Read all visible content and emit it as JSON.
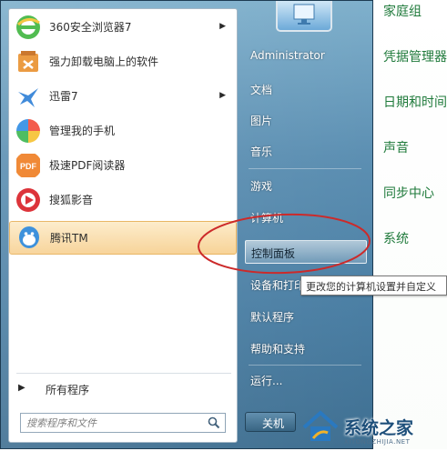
{
  "right_window": {
    "links": [
      "家庭组",
      "凭据管理器",
      "日期和时间",
      "声音",
      "同步中心",
      "系统"
    ]
  },
  "programs": [
    {
      "label": "360安全浏览器7",
      "icon": "360-browser-icon",
      "submenu": true
    },
    {
      "label": "强力卸载电脑上的软件",
      "icon": "uninstall-tool-icon",
      "submenu": false
    },
    {
      "label": "迅雷7",
      "icon": "thunder-bird-icon",
      "submenu": true
    },
    {
      "label": "管理我的手机",
      "icon": "phone-manager-icon",
      "submenu": false
    },
    {
      "label": "极速PDF阅读器",
      "icon": "pdf-reader-icon",
      "submenu": false
    },
    {
      "label": "搜狐影音",
      "icon": "sohu-player-icon",
      "submenu": false
    },
    {
      "label": "腾讯TM",
      "icon": "tencent-tm-icon",
      "submenu": false
    }
  ],
  "all_programs": "所有程序",
  "search": {
    "placeholder": "搜索程序和文件"
  },
  "right_menu": {
    "user": "Administrator",
    "documents": "文档",
    "pictures": "图片",
    "music": "音乐",
    "games": "游戏",
    "computer": "计算机",
    "control_panel": "控制面板",
    "devices": "设备和打印机",
    "default_programs": "默认程序",
    "help": "帮助和支持",
    "run": "运行..."
  },
  "shutdown": {
    "label": "关机"
  },
  "tooltip": "更改您的计算机设置并自定义",
  "watermark": {
    "text": "系统之家",
    "sub": "XITONGZHIJIA.NET"
  },
  "colors": {
    "annotation": "#cc2a2a",
    "link_green": "#1f7a3b",
    "highlight": "#f7d193"
  }
}
